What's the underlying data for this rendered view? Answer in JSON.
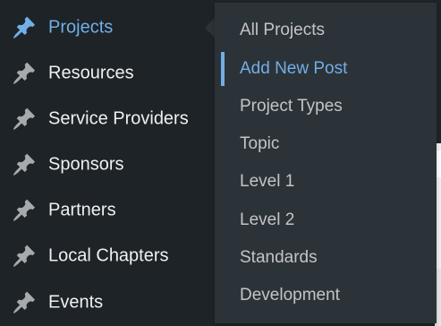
{
  "colors": {
    "menu_bg": "#1d2327",
    "submenu_bg": "#2c3338",
    "text": "#f0f0f1",
    "submenu_text": "#c3c4c7",
    "accent": "#72aee6"
  },
  "admin_menu": {
    "items": [
      {
        "label": "Projects",
        "icon": "pin-icon",
        "current": true
      },
      {
        "label": "Resources",
        "icon": "pin-icon"
      },
      {
        "label": "Service Providers",
        "icon": "pin-icon"
      },
      {
        "label": "Sponsors",
        "icon": "pin-icon"
      },
      {
        "label": "Partners",
        "icon": "pin-icon"
      },
      {
        "label": "Local Chapters",
        "icon": "pin-icon"
      },
      {
        "label": "Events",
        "icon": "pin-icon"
      }
    ]
  },
  "submenu": {
    "items": [
      {
        "label": "All Projects"
      },
      {
        "label": "Add New Post",
        "active": true
      },
      {
        "label": "Project Types"
      },
      {
        "label": "Topic"
      },
      {
        "label": "Level 1"
      },
      {
        "label": "Level 2"
      },
      {
        "label": "Standards"
      },
      {
        "label": "Development"
      }
    ]
  }
}
